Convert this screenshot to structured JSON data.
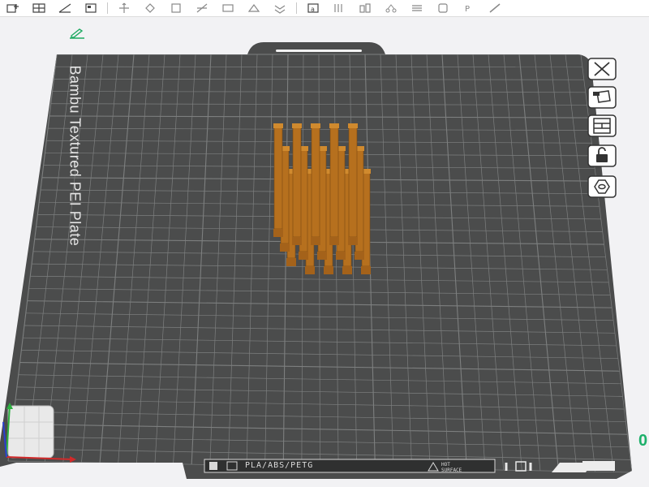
{
  "toolbar": {
    "tools": [
      "add-icon",
      "grid-icon",
      "auto-orient-icon",
      "arrange-icon",
      "move-icon",
      "rotate-icon",
      "scale-icon",
      "cut-icon",
      "paint-icon",
      "support-icon",
      "seam-icon",
      "text-icon",
      "measure-icon",
      "assembly-icon",
      "split-icon",
      "layers-icon",
      "variable-layer-icon",
      "sla-icon"
    ]
  },
  "plate": {
    "name": "Bambu Textured PEI Plate",
    "filament_types": "PLA/ABS/PETG",
    "hot_surface_line1": "HOT",
    "hot_surface_line2": "SURFACE",
    "plate_color": "#4b4c4c",
    "grid_color": "#7d7f7f"
  },
  "side_controls": [
    {
      "name": "close-plate-button",
      "icon": "close-icon"
    },
    {
      "name": "auto-arrange-button",
      "icon": "arrange-plate-icon"
    },
    {
      "name": "plate-layout-button",
      "icon": "layout-icon"
    },
    {
      "name": "lock-plate-button",
      "icon": "lock-icon"
    },
    {
      "name": "plate-settings-button",
      "icon": "settings-hex-icon"
    }
  ],
  "model": {
    "color": "#b6701e",
    "rows": 3,
    "columns": 5
  },
  "coordinate_readout": "0"
}
